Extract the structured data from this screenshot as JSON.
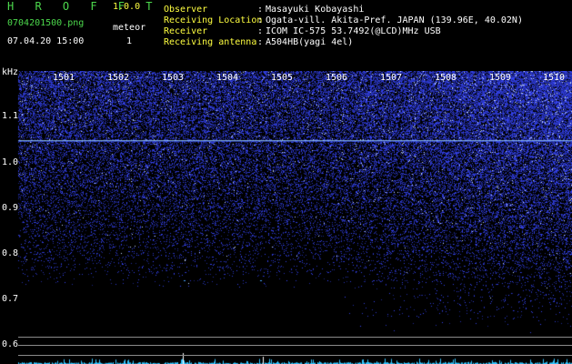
{
  "header": {
    "brand": "H R O F F T",
    "version": "1.0.0",
    "filename": "0704201500.png",
    "datetime": "07.04.20 15:00",
    "meteor_label": "meteor",
    "meteor_count": "1"
  },
  "info": [
    {
      "key": "Observer",
      "sep": ":",
      "value": "Masayuki Kobayashi"
    },
    {
      "key": "Receiving Location",
      "sep": ":",
      "value": "Ogata-vill. Akita-Pref. JAPAN (139.96E, 40.02N)"
    },
    {
      "key": "Receiver",
      "sep": ":",
      "value": "ICOM IC-575 53.7492(@LCD)MHz USB"
    },
    {
      "key": "Receiving antenna",
      "sep": ":",
      "value": "A504HB(yagi 4el)"
    }
  ],
  "spectrogram": {
    "unit_label": "kHz",
    "time_labels": [
      "1501",
      "1502",
      "1503",
      "1504",
      "1505",
      "1506",
      "1507",
      "1508",
      "1509",
      "1510"
    ],
    "freq_labels": [
      "1.1",
      "1.0",
      "0.9",
      "0.8",
      "0.7",
      "0.6"
    ],
    "colors": {
      "background": "#000000",
      "signal": "#3a4bff",
      "hot": "#dfe9ff",
      "trace": "#35c6ff"
    }
  }
}
